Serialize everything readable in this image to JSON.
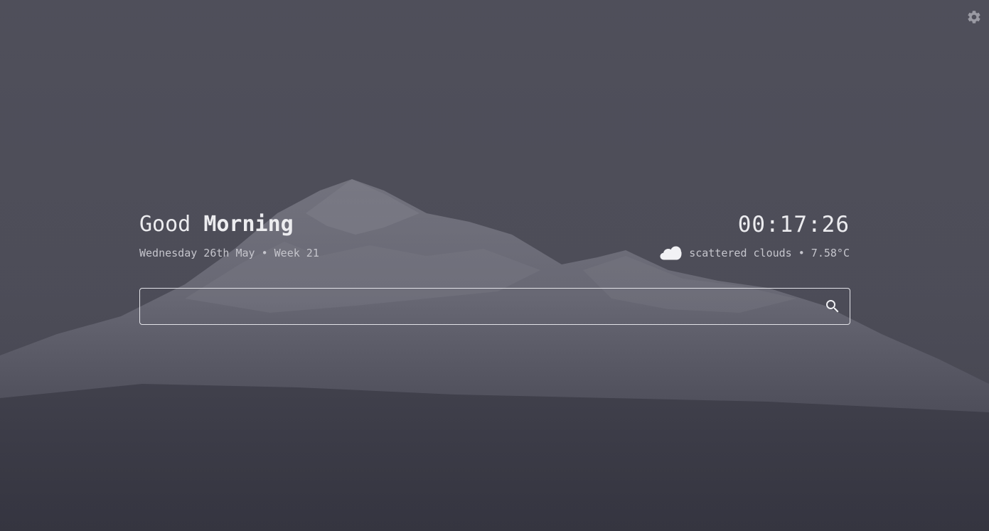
{
  "greeting": {
    "prefix": "Good",
    "emphasis": "Morning"
  },
  "date": {
    "text": "Wednesday 26th May • Week 21"
  },
  "clock": {
    "time": "00:17:26"
  },
  "weather": {
    "icon": "cloud-icon",
    "text": "scattered clouds • 7.58°C"
  },
  "search": {
    "placeholder": "",
    "value": "",
    "icon": "search-icon"
  },
  "settings": {
    "icon": "gear-icon"
  },
  "background": {
    "subject": "snow-capped mountain",
    "colors": {
      "sky": "#4f4f5a",
      "ground": "#393944",
      "snow": "#8e8e99"
    }
  }
}
